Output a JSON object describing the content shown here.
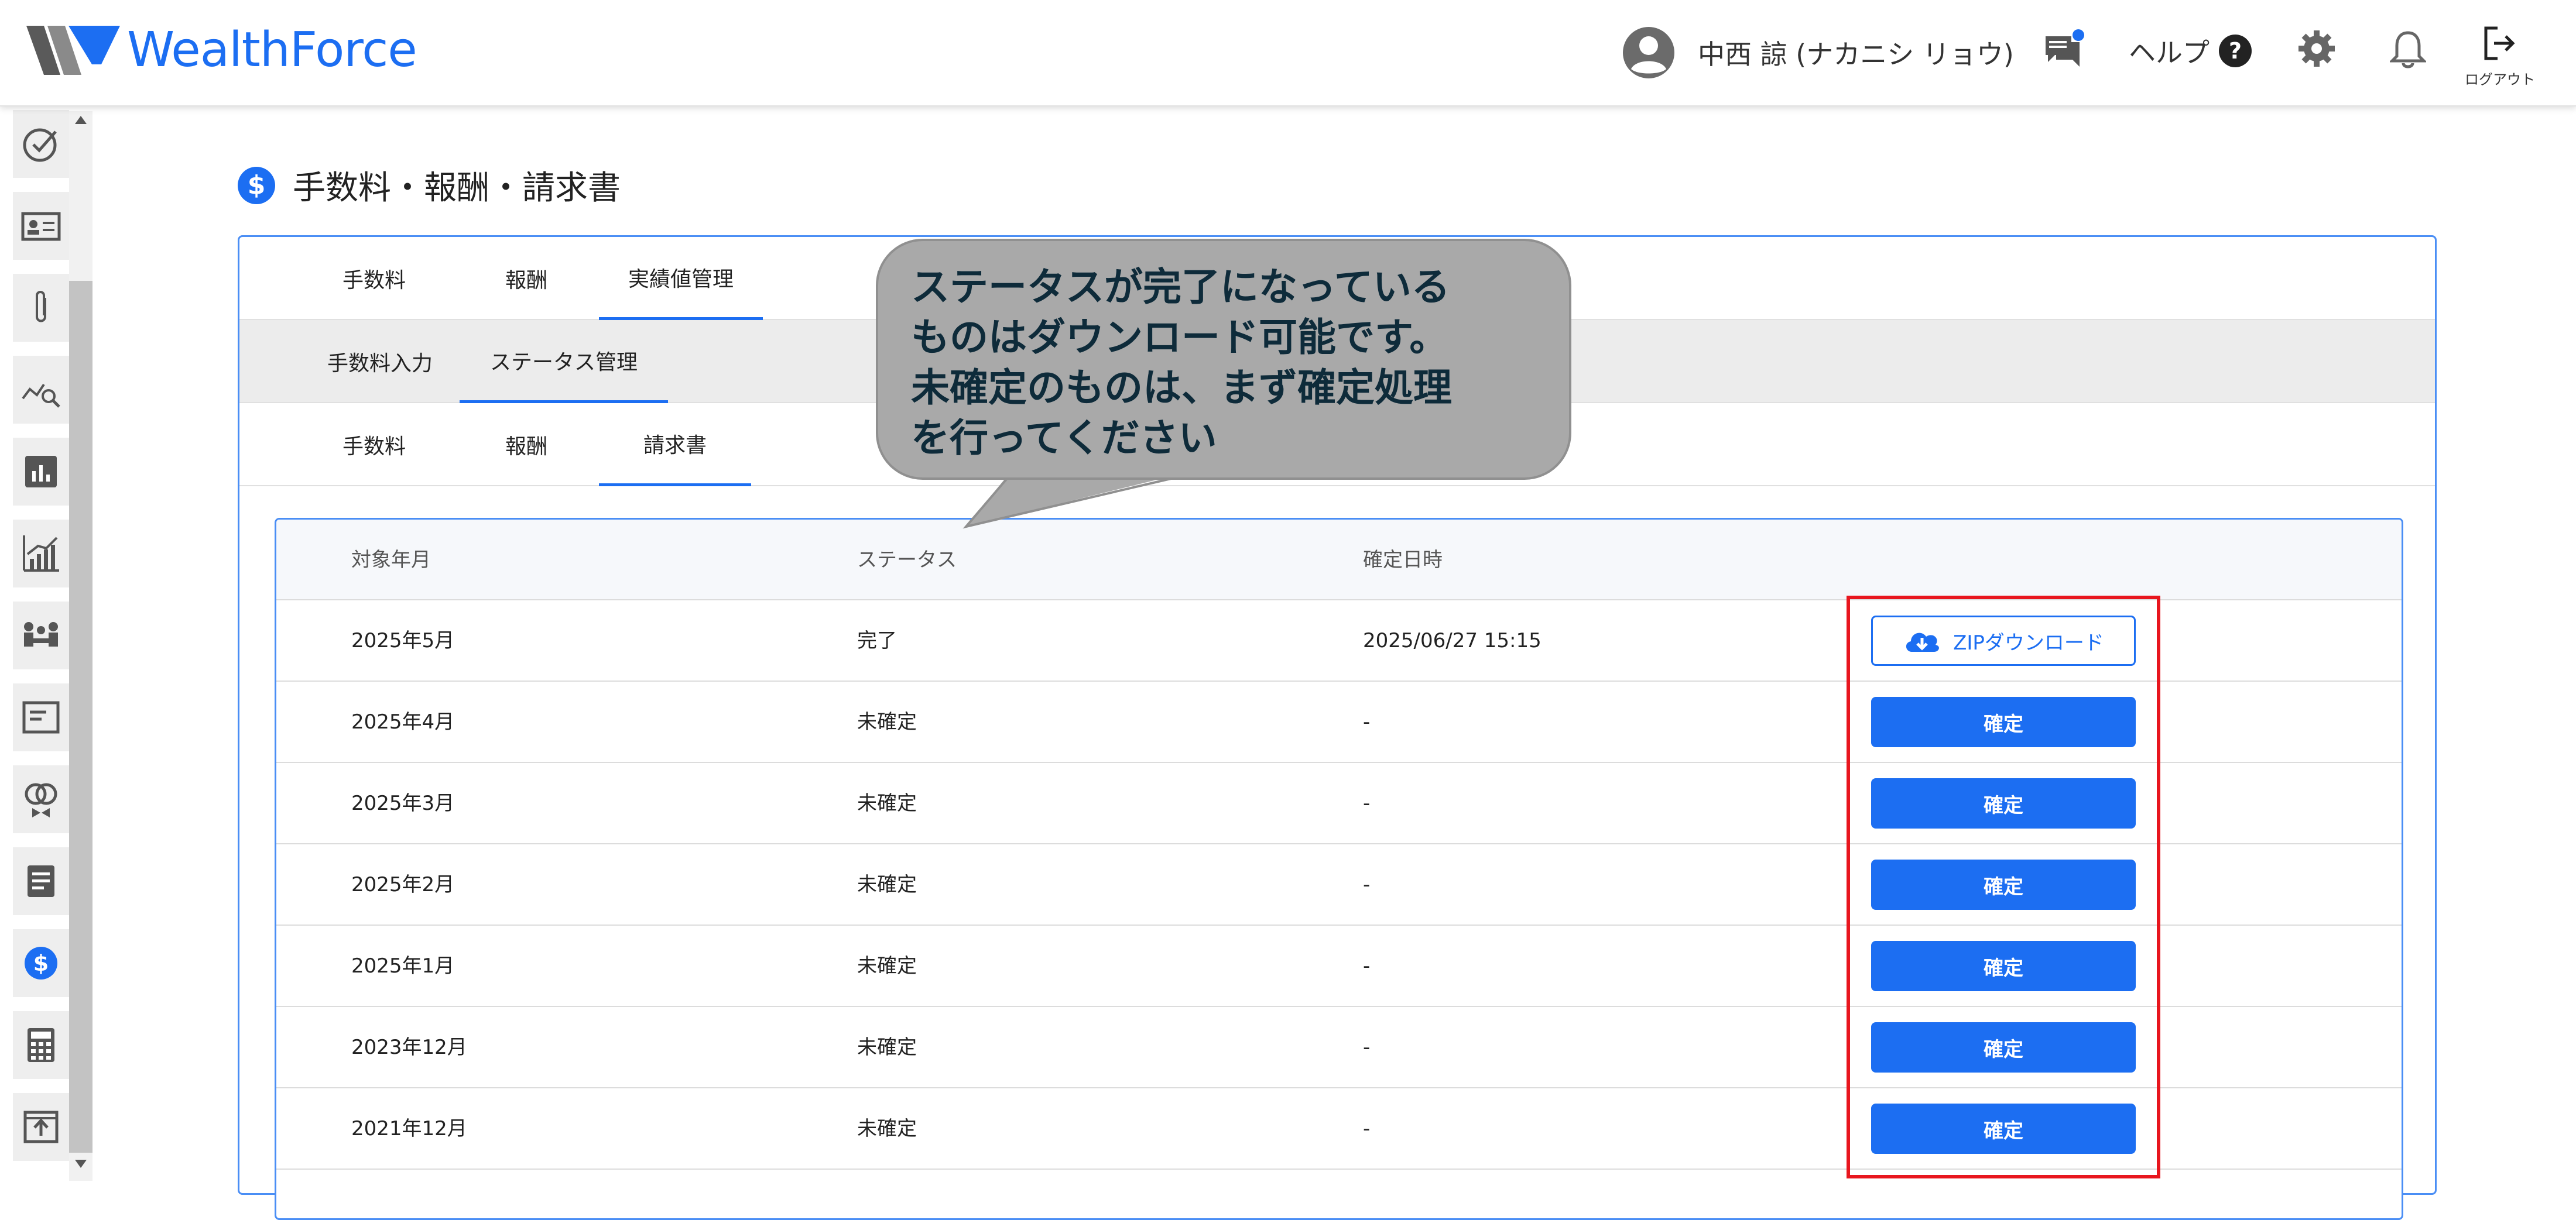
{
  "header": {
    "brand": "WealthForce",
    "user_name": "中西 諒 (ナカニシ リョウ)",
    "help_label": "ヘルプ",
    "logout_label": "ログアウト"
  },
  "sidebar": {
    "icons": [
      "check-circle-icon",
      "id-card-icon",
      "paperclip-icon",
      "chart-search-icon",
      "bar-chart-icon",
      "growth-chart-icon",
      "meeting-icon",
      "browser-window-icon",
      "rings-icon",
      "document-icon",
      "dollar-icon",
      "calculator-icon",
      "upload-icon"
    ],
    "active_index": 10
  },
  "page": {
    "title": "手数料・報酬・請求書"
  },
  "tabs_level1": [
    {
      "label": "手数料"
    },
    {
      "label": "報酬"
    },
    {
      "label": "実績値管理"
    }
  ],
  "tabs_level2": [
    {
      "label": "手数料入力"
    },
    {
      "label": "ステータス管理"
    }
  ],
  "tabs_level3": [
    {
      "label": "手数料"
    },
    {
      "label": "報酬"
    },
    {
      "label": "請求書"
    }
  ],
  "table": {
    "columns": [
      "対象年月",
      "ステータス",
      "確定日時"
    ],
    "rows": [
      {
        "month": "2025年5月",
        "status": "完了",
        "confirmed_at": "2025/06/27 15:15",
        "action": "ZIPダウンロード"
      },
      {
        "month": "2025年4月",
        "status": "未確定",
        "confirmed_at": "-",
        "action": "確定"
      },
      {
        "month": "2025年3月",
        "status": "未確定",
        "confirmed_at": "-",
        "action": "確定"
      },
      {
        "month": "2025年2月",
        "status": "未確定",
        "confirmed_at": "-",
        "action": "確定"
      },
      {
        "month": "2025年1月",
        "status": "未確定",
        "confirmed_at": "-",
        "action": "確定"
      },
      {
        "month": "2023年12月",
        "status": "未確定",
        "confirmed_at": "-",
        "action": "確定"
      },
      {
        "month": "2021年12月",
        "status": "未確定",
        "confirmed_at": "-",
        "action": "確定"
      }
    ]
  },
  "callout": {
    "lines": [
      "ステータスが完了になっている",
      "ものはダウンロード可能です。",
      "未確定のものは、まず確定処理",
      "を行ってください"
    ]
  },
  "colors": {
    "accent": "#1c6ef2",
    "highlight": "#e8161e",
    "callout_bg": "#a9a9a9"
  }
}
